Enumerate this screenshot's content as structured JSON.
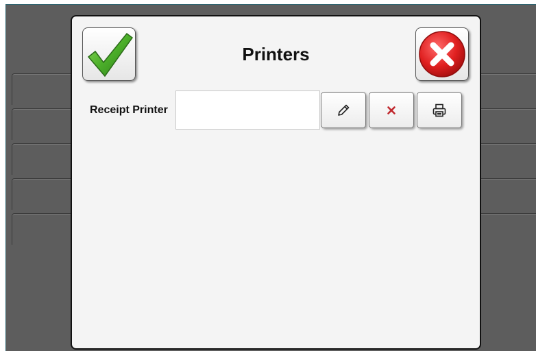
{
  "dialog": {
    "title": "Printers",
    "confirm_icon": "checkmark-icon",
    "close_icon": "close-x-icon"
  },
  "receipt_printer": {
    "label": "Receipt Printer",
    "value": "",
    "edit_icon": "pencil-icon",
    "clear_icon": "x-icon",
    "test_icon": "printer-icon"
  },
  "colors": {
    "background": "#5d5d5d",
    "dialog": "#f4f4f4",
    "check_green": "#4caf2a",
    "close_red": "#e02020",
    "clear_red": "#c0272d"
  }
}
